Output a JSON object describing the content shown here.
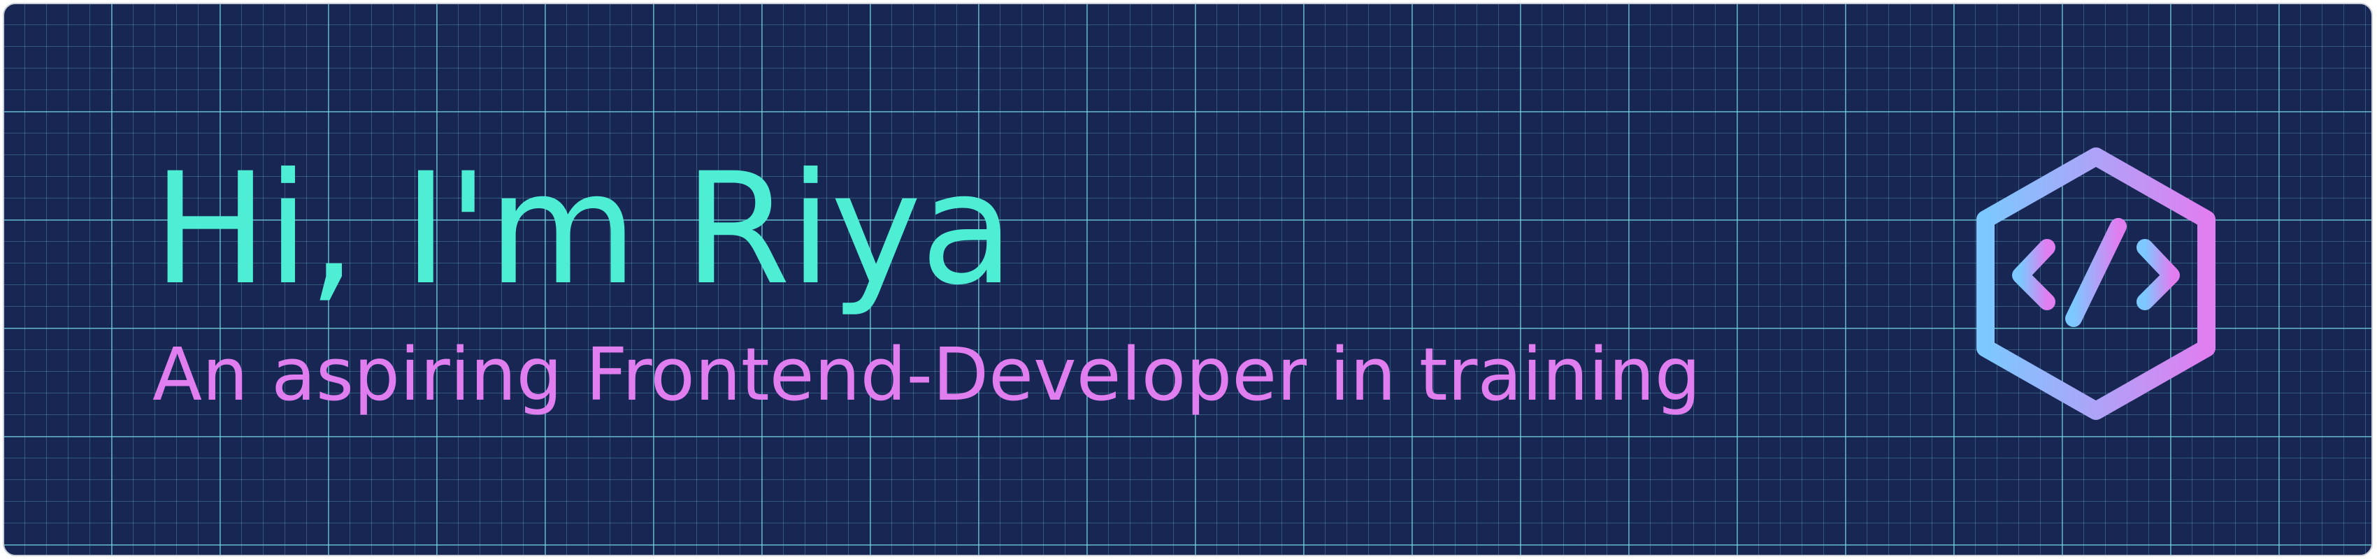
{
  "banner": {
    "headline": "Hi, I'm Riya",
    "tagline": "An aspiring Frontend-Developer in training",
    "logo_icon": "code-hexagon-icon"
  },
  "colors": {
    "background": "#172652",
    "grid": "#78dce6",
    "headline": "#4eeed5",
    "tagline": "#e07ef0",
    "icon_gradient_start": "#7cc8ff",
    "icon_gradient_end": "#e07ef0"
  }
}
